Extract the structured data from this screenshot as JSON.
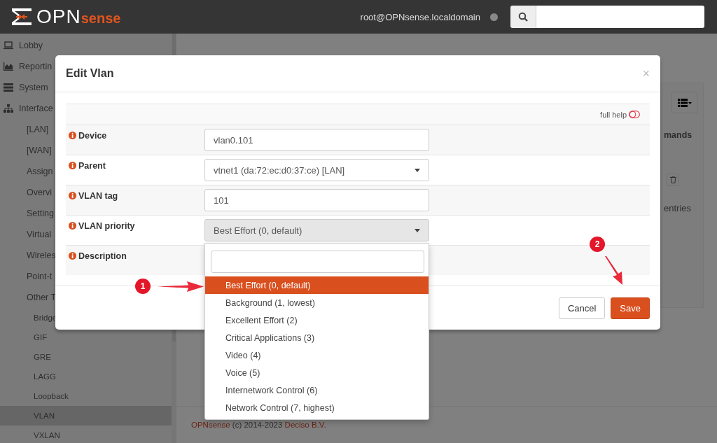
{
  "header": {
    "logo": {
      "part_1": "OPN",
      "part_2": "sense"
    },
    "user": "root@OPNsense.localdomain"
  },
  "sidebar": {
    "items": [
      {
        "label": "Lobby",
        "selected": false
      },
      {
        "label": "Reportin",
        "selected": false
      },
      {
        "label": "System",
        "selected": false
      },
      {
        "label": "Interface",
        "selected": false,
        "children": [
          {
            "label": "[LAN]",
            "selected": false
          },
          {
            "label": "[WAN]",
            "selected": false
          },
          {
            "label": "Assign",
            "selected": false
          },
          {
            "label": "Overvi",
            "selected": false
          },
          {
            "label": "Setting",
            "selected": false
          },
          {
            "label": "Virtual",
            "selected": false
          },
          {
            "label": "Wireles",
            "selected": false
          },
          {
            "label": "Point-t",
            "selected": false
          },
          {
            "label": "Other T",
            "selected": false,
            "children": [
              {
                "label": "Bridge",
                "selected": false
              },
              {
                "label": "GIF",
                "selected": false
              },
              {
                "label": "GRE",
                "selected": false
              },
              {
                "label": "LAGG",
                "selected": false
              },
              {
                "label": "Loopback",
                "selected": false
              },
              {
                "label": "VLAN",
                "selected": true
              },
              {
                "label": "VXLAN",
                "selected": false
              }
            ]
          }
        ]
      }
    ]
  },
  "main": {
    "panel": {
      "column_header": "mands",
      "footer_text": "entries"
    }
  },
  "footer": {
    "brand_link": "OPNsense",
    "copyright": "(c) 2014-2023",
    "company_link": "Deciso B.V."
  },
  "modal": {
    "title": "Edit Vlan",
    "close": "×",
    "full_help": {
      "label": "full help",
      "on": false
    },
    "fields": [
      {
        "label": "Device",
        "kind": "text",
        "value": "vlan0.101"
      },
      {
        "label": "Parent",
        "kind": "select",
        "value": "vtnet1 (da:72:ec:d0:37:ce) [LAN]",
        "open": false
      },
      {
        "label": "VLAN tag",
        "kind": "text",
        "value": "101"
      },
      {
        "label": "VLAN priority",
        "kind": "select",
        "value": "Best Effort (0, default)",
        "open": true
      },
      {
        "label": "Description"
      }
    ],
    "dropdown": {
      "options": [
        {
          "label": "Best Effort (0, default)",
          "selected": true
        },
        {
          "label": "Background (1, lowest)",
          "selected": false
        },
        {
          "label": "Excellent Effort (2)",
          "selected": false
        },
        {
          "label": "Critical Applications (3)",
          "selected": false
        },
        {
          "label": "Video (4)",
          "selected": false
        },
        {
          "label": "Voice (5)",
          "selected": false
        },
        {
          "label": "Internetwork Control (6)",
          "selected": false
        },
        {
          "label": "Network Control (7, highest)",
          "selected": false
        }
      ]
    },
    "buttons": [
      {
        "label": "Cancel",
        "kind": "default"
      },
      {
        "label": "Save",
        "kind": "primary"
      }
    ]
  },
  "annotations": [
    {
      "label": "1",
      "kind": "arrow-right"
    },
    {
      "label": "2",
      "kind": "arrow-down"
    }
  ]
}
